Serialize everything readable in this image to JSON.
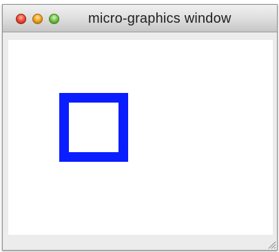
{
  "window": {
    "title": "micro-graphics window"
  },
  "controls": {
    "close": "close-button",
    "minimize": "minimize-button",
    "zoom": "zoom-button"
  },
  "canvas": {
    "shape": "square-outline",
    "stroke_color": "#0a1eff"
  }
}
